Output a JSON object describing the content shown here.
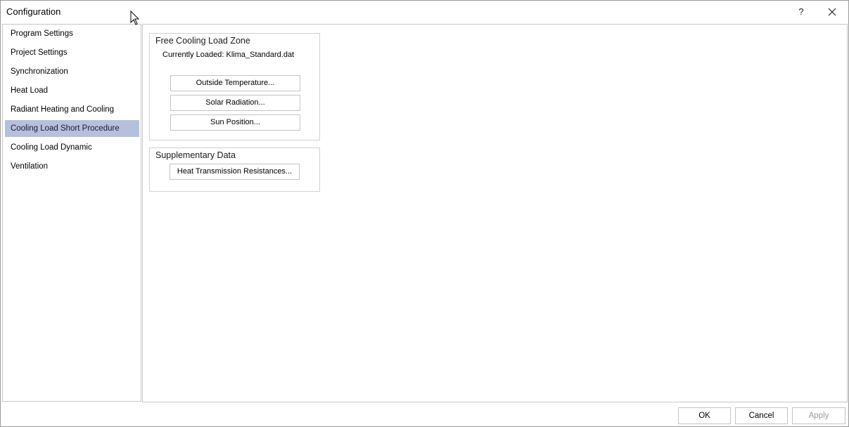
{
  "window": {
    "title": "Configuration",
    "help_label": "?"
  },
  "sidebar": {
    "items": [
      {
        "label": "Program Settings"
      },
      {
        "label": "Project Settings"
      },
      {
        "label": "Synchronization"
      },
      {
        "label": "Heat Load"
      },
      {
        "label": "Radiant Heating and Cooling"
      },
      {
        "label": "Cooling Load Short Procedure",
        "selected": true
      },
      {
        "label": "Cooling Load Dynamic"
      },
      {
        "label": "Ventilation"
      }
    ]
  },
  "main": {
    "free_cooling_group": {
      "title": "Free Cooling Load Zone",
      "currently_loaded": "Currently Loaded: Klima_Standard.dat",
      "buttons": [
        {
          "label": "Outside Temperature..."
        },
        {
          "label": "Solar Radiation..."
        },
        {
          "label": "Sun Position..."
        }
      ]
    },
    "supplementary_group": {
      "title": "Supplementary Data",
      "buttons": [
        {
          "label": "Heat Transmission Resistances..."
        }
      ]
    }
  },
  "footer": {
    "ok_label": "OK",
    "cancel_label": "Cancel",
    "apply_label": "Apply"
  },
  "colors": {
    "selected_item_bg": "#b4c0dc",
    "border": "#c8c8c8",
    "disabled_text": "#9a9a9a"
  },
  "icons": {
    "close": "close-icon",
    "cursor": "mouse-pointer-icon"
  }
}
